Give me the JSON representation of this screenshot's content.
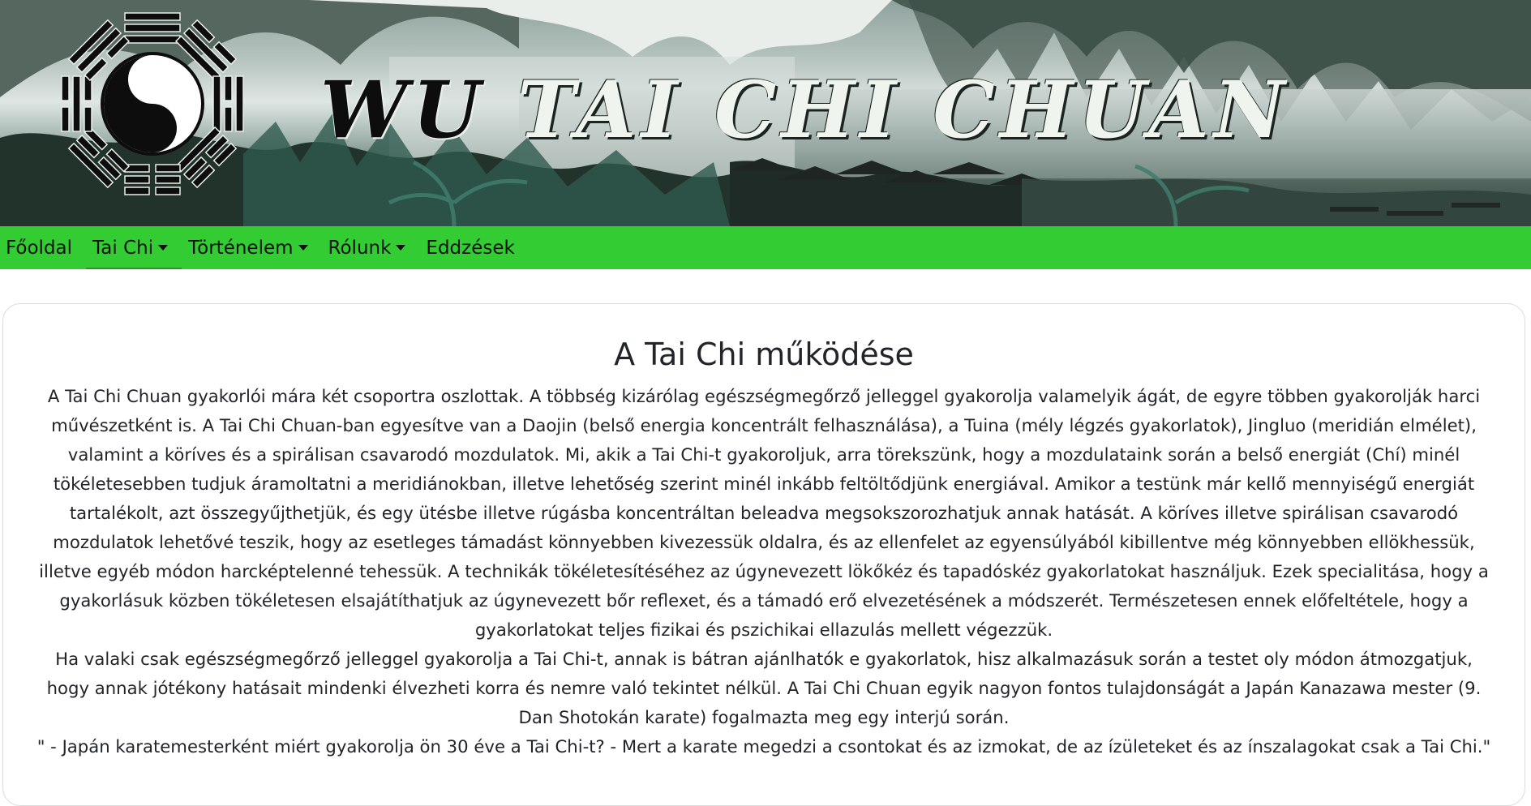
{
  "banner": {
    "title_part1": "WU",
    "title_part2": "TAI CHI CHUAN",
    "emblem_icon": "yin-yang-bagua-icon"
  },
  "nav": {
    "items": [
      {
        "label": "Főoldal",
        "dropdown": false
      },
      {
        "label": "Tai Chi",
        "dropdown": true
      },
      {
        "label": "Történelem",
        "dropdown": true
      },
      {
        "label": "Rólunk",
        "dropdown": true
      },
      {
        "label": "Eddzések",
        "dropdown": false
      }
    ],
    "active_index": 1,
    "color": "#33cc33"
  },
  "content": {
    "title": "A Tai Chi működése",
    "paragraphs": [
      "A Tai Chi Chuan gyakorlói mára két csoportra oszlottak. A többség kizárólag egészségmegőrző jelleggel gyakorolja valamelyik ágát, de egyre többen gyakorolják harci művészetként is. A Tai Chi Chuan-ban egyesítve van a Daojin (belső energia koncentrált felhasználása), a Tuina (mély légzés gyakorlatok), Jingluo (meridián elmélet), valamint a köríves és a spirálisan csavarodó mozdulatok. Mi, akik a Tai Chi-t gyakoroljuk, arra törekszünk, hogy a mozdulataink során a belső energiát (Chí) minél tökéletesebben tudjuk áramoltatni a meridiánokban, illetve lehetőség szerint minél inkább feltöltődjünk energiával. Amikor a testünk már kellő mennyiségű energiát tartalékolt, azt összegyűjthetjük, és egy ütésbe illetve rúgásba koncentráltan beleadva megsokszorozhatjuk annak hatását. A köríves illetve spirálisan csavarodó mozdulatok lehetővé teszik, hogy az esetleges támadást könnyebben kivezessük oldalra, és az ellenfelet az egyensúlyából kibillentve még könnyebben ellökhessük, illetve egyéb módon harcképtelenné tehessük. A technikák tökéletesítéséhez az úgynevezett lökőkéz és tapadóskéz gyakorlatokat használjuk. Ezek specialitása, hogy a gyakorlásuk közben tökéletesen elsajátíthatjuk az úgynevezett bőr reflexet, és a támadó erő elvezetésének a módszerét. Természetesen ennek előfeltétele, hogy a gyakorlatokat teljes fizikai és pszichikai ellazulás mellett végezzük.",
      "Ha valaki csak egészségmegőrző jelleggel gyakorolja a Tai Chi-t, annak is bátran ajánlhatók e gyakorlatok, hisz alkalmazásuk során a testet oly módon átmozgatjuk, hogy annak jótékony hatásait mindenki élvezheti korra és nemre való tekintet nélkül. A Tai Chi Chuan egyik nagyon fontos tulajdonságát a Japán Kanazawa mester (9. Dan Shotokán karate) fogalmazta meg egy interjú során.",
      "\" - Japán karatemesterként miért gyakorolja ön 30 éve a Tai Chi-t? - Mert a karate megedzi a csontokat és az izmokat, de az ízületeket és az ínszalagokat csak a Tai Chi.\""
    ]
  }
}
